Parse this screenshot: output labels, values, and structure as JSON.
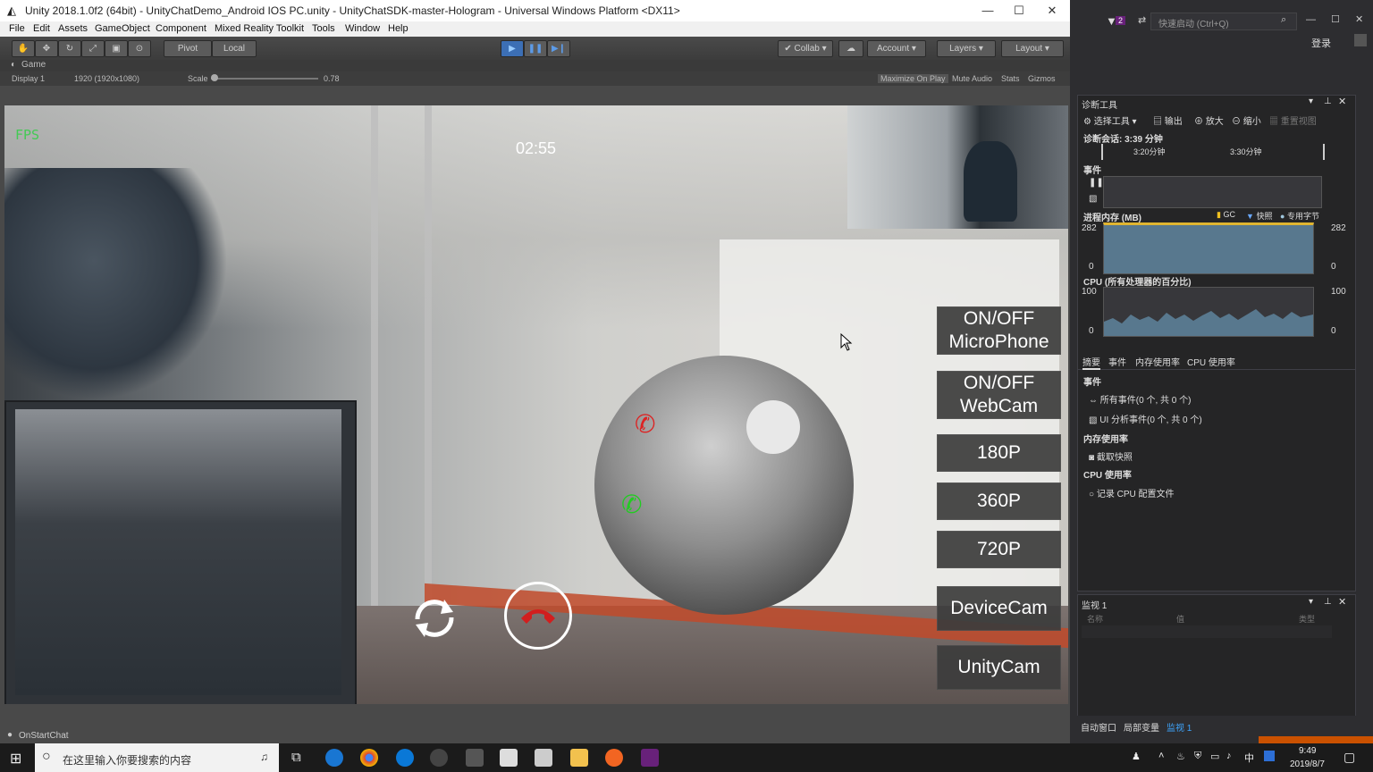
{
  "unity": {
    "title": "Unity 2018.1.0f2 (64bit) - UnityChatDemo_Android IOS PC.unity - UnityChatSDK-master-Hologram - Universal Windows Platform <DX11>",
    "menu": [
      "File",
      "Edit",
      "Assets",
      "GameObject",
      "Component",
      "Mixed Reality Toolkit",
      "Tools",
      "Window",
      "Help"
    ],
    "toolbar": {
      "pivot": "Pivot",
      "local": "Local",
      "collab": "Collab",
      "account": "Account",
      "layers": "Layers",
      "layout": "Layout"
    },
    "game_tab": "Game",
    "game_bar": {
      "display": "Display 1",
      "resolution": "1920 (1920x1080)",
      "scale_label": "Scale",
      "scale_value": "0.78",
      "maximize": "Maximize On Play",
      "mute": "Mute Audio",
      "stats": "Stats",
      "gizmos": "Gizmos"
    },
    "status": "OnStartChat"
  },
  "game": {
    "fps": "FPS  ",
    "timer": "02:55",
    "buttons": [
      {
        "label": "ON/OFF\nMicroPhone"
      },
      {
        "label": "ON/OFF\nWebCam"
      },
      {
        "label": "180P"
      },
      {
        "label": "360P"
      },
      {
        "label": "720P"
      },
      {
        "label": "DeviceCam"
      },
      {
        "label": "UnityCam"
      }
    ]
  },
  "vs": {
    "quick_launch": "快速启动 (Ctrl+Q)",
    "notification_count": "2",
    "login": "登录",
    "diag_title": "诊断工具",
    "diag_toolbar": {
      "select_tool": "选择工具",
      "output": "输出",
      "zoom_in": "放大",
      "zoom_out": "缩小",
      "reset_view": "重置视图"
    },
    "session": "诊断会话: 3:39 分钟",
    "timeline_ticks": [
      "3:20分钟",
      "3:30分钟"
    ],
    "events_label": "事件",
    "memory": {
      "label": "进程内存 (MB)",
      "legend": [
        "GC",
        "快照",
        "专用字节"
      ],
      "max": "282",
      "min": "0"
    },
    "cpu": {
      "label": "CPU (所有处理器的百分比)",
      "max": "100",
      "min": "0"
    },
    "tabs": [
      "摘要",
      "事件",
      "内存使用率",
      "CPU 使用率"
    ],
    "summary": {
      "events_header": "事件",
      "all_events": "所有事件(0 个, 共 0 个)",
      "ui_events": "UI 分析事件(0 个, 共 0 个)",
      "memory_header": "内存使用率",
      "snapshot": "截取快照",
      "cpu_header": "CPU 使用率",
      "record_cpu": "记录 CPU 配置文件"
    },
    "watch": {
      "title": "监视 1",
      "columns": [
        "名称",
        "值",
        "类型"
      ]
    },
    "bottom_tabs": [
      "自动窗口",
      "局部变量",
      "监视 1"
    ]
  },
  "taskbar": {
    "search_placeholder": "在这里输入你要搜索的内容",
    "ime": "中",
    "time": "9:49",
    "date": "2019/8/7"
  }
}
